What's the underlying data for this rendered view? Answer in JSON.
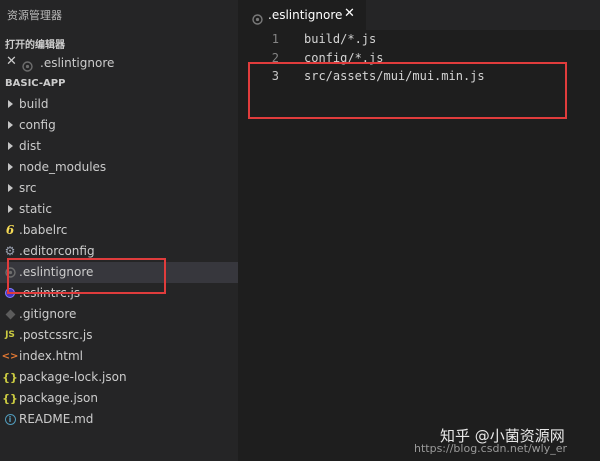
{
  "sidebar": {
    "title": "资源管理器",
    "open_editors_header": "打开的编辑器",
    "open_editor": {
      "close": "✕",
      "label": ".eslintignore"
    },
    "project_header": "BASIC-APP",
    "items": [
      {
        "label": "build",
        "icon": "folder-chevron"
      },
      {
        "label": "config",
        "icon": "folder-chevron"
      },
      {
        "label": "dist",
        "icon": "folder-chevron"
      },
      {
        "label": "node_modules",
        "icon": "folder-chevron"
      },
      {
        "label": "src",
        "icon": "folder-chevron"
      },
      {
        "label": "static",
        "icon": "folder-chevron"
      },
      {
        "label": ".babelrc",
        "icon": "babel-icon",
        "glyph": "6"
      },
      {
        "label": ".editorconfig",
        "icon": "gear-icon",
        "glyph": "⚙"
      },
      {
        "label": ".eslintignore",
        "icon": "ignore-file-icon"
      },
      {
        "label": ".eslintrc.js",
        "icon": "eslint-icon"
      },
      {
        "label": ".gitignore",
        "icon": "git-icon"
      },
      {
        "label": ".postcssrc.js",
        "icon": "js-icon",
        "glyph": "JS"
      },
      {
        "label": "index.html",
        "icon": "html-icon",
        "glyph": "<>"
      },
      {
        "label": "package-lock.json",
        "icon": "json-icon",
        "glyph": "{}"
      },
      {
        "label": "package.json",
        "icon": "json-icon",
        "glyph": "{}"
      },
      {
        "label": "README.md",
        "icon": "info-icon",
        "glyph": "i"
      }
    ]
  },
  "editor": {
    "tab": {
      "label": ".eslintignore",
      "close": "✕"
    },
    "lines": [
      {
        "num": "1",
        "text": "build/*.js"
      },
      {
        "num": "2",
        "text": "config/*.js"
      },
      {
        "num": "3",
        "text": "src/assets/mui/mui.min.js"
      }
    ]
  },
  "watermark": {
    "main": "知乎 @小菌资源网",
    "url": "https://blog.csdn.net/wly_er"
  },
  "colors": {
    "annotation_red": "#e03c3c",
    "sidebar_bg": "#252526",
    "editor_bg": "#1e1e1e",
    "selected_row": "#37373d"
  }
}
